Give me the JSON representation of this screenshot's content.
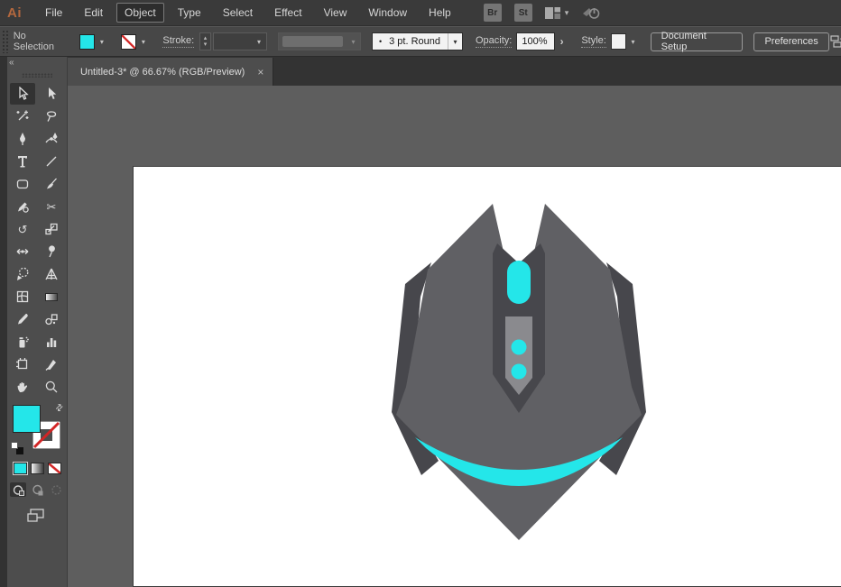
{
  "colors": {
    "accent_cyan": "#24E6E9",
    "mouse_body_gray": "#606064",
    "mouse_dark_gray": "#47474C",
    "mouse_light_gray": "#8A8A8E",
    "artboard_white": "#FFFFFF",
    "pasteboard_gray": "#5E5E5E",
    "none_red": "#D22525",
    "logo_orange": "#B4683E"
  },
  "menubar": {
    "logo": "Ai",
    "items": [
      "File",
      "Edit",
      "Object",
      "Type",
      "Select",
      "Effect",
      "View",
      "Window",
      "Help"
    ],
    "active_item": "Object",
    "bridge_label": "Br",
    "stock_label": "St",
    "workspace_chevron": "⌄"
  },
  "controlbar": {
    "selection_status": "No Selection",
    "stroke_label": "Stroke:",
    "stepper_up": "▴",
    "stepper_down": "▾",
    "dropdown_chevron": "▾",
    "brush_bullet": "•",
    "brush_profile_value": "3 pt. Round",
    "opacity_label": "Opacity:",
    "opacity_value": "100%",
    "opacity_arrow": "›",
    "style_label": "Style:",
    "document_setup_label": "Document Setup",
    "preferences_label": "Preferences"
  },
  "tabbar": {
    "tabs": [
      {
        "title": "Untitled-3* @ 66.67% (RGB/Preview)",
        "active": true
      }
    ],
    "close_glyph": "×"
  },
  "toolbar": {
    "collapse_glyph": "«",
    "swap_glyph": "⇄",
    "active_tool": "selection",
    "tools": [
      "selection",
      "direct-selection",
      "magic-wand",
      "lasso",
      "pen",
      "curvature",
      "type",
      "line-segment",
      "rectangle",
      "paintbrush",
      "shaper",
      "scissors",
      "rotate",
      "scale",
      "width",
      "puppet-warp",
      "shape-builder",
      "perspective-grid",
      "mesh",
      "gradient",
      "eyedropper",
      "blend",
      "symbol-sprayer",
      "column-graph",
      "artboard",
      "slice",
      "hand",
      "zoom"
    ],
    "color_modes": [
      "color",
      "gradient",
      "none"
    ],
    "draw_modes": [
      "draw-normal",
      "draw-behind",
      "draw-inside"
    ],
    "fill_color": "#24E6E9",
    "stroke_value": "None"
  },
  "canvas": {
    "artboard_document": "Untitled-3",
    "zoom_level": "66.67%",
    "color_mode": "RGB/Preview",
    "artwork": "gaming-mouse-flat-illustration"
  }
}
